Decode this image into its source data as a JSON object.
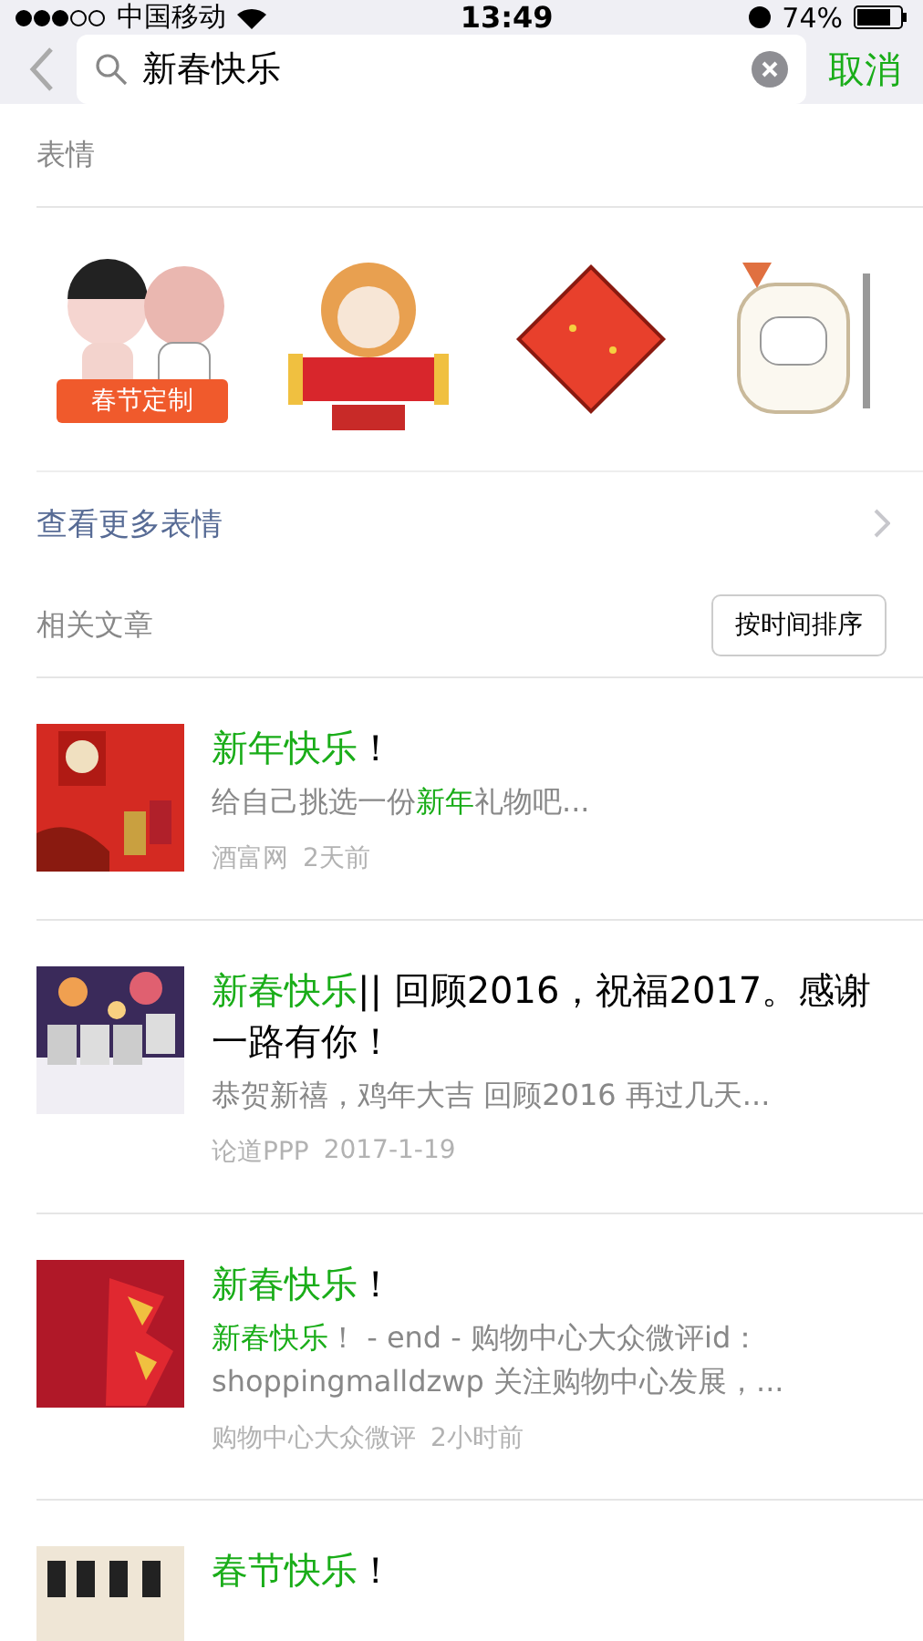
{
  "status_bar": {
    "carrier": "中国移动",
    "time": "13:49",
    "battery": "74%"
  },
  "search": {
    "value": "新春快乐",
    "cancel": "取消"
  },
  "stickers": {
    "title": "表情",
    "items": [
      {
        "kind": "picture",
        "badge": "春节定制"
      },
      {
        "kind": "picture"
      },
      {
        "kind": "picture"
      },
      {
        "kind": "picture"
      }
    ],
    "more": "查看更多表情"
  },
  "articles": {
    "title": "相关文章",
    "sort_button": "按时间排序",
    "items": [
      {
        "title": [
          {
            "text": "新年快乐",
            "highlight": true
          },
          {
            "text": "！",
            "highlight": false
          }
        ],
        "summary": [
          {
            "text": "给自己挑选一份",
            "highlight": false
          },
          {
            "text": "新年",
            "highlight": true
          },
          {
            "text": "礼物吧...",
            "highlight": false
          }
        ],
        "source": "酒富网",
        "time": "2天前"
      },
      {
        "title": [
          {
            "text": "新春快乐",
            "highlight": true
          },
          {
            "text": "|| 回顾2016，祝福2017。感谢一路有你！",
            "highlight": false
          }
        ],
        "summary": [
          {
            "text": "恭贺新禧，鸡年大吉 回顾2016 再过几天...",
            "highlight": false
          }
        ],
        "source": "论道PPP",
        "time": "2017-1-19"
      },
      {
        "title": [
          {
            "text": "新春快乐",
            "highlight": true
          },
          {
            "text": "！",
            "highlight": false
          }
        ],
        "summary": [
          {
            "text": "新春快乐",
            "highlight": true
          },
          {
            "text": "！  - end - 购物中心大众微评id：shoppingmalldzwp 关注购物中心发展，...",
            "highlight": false
          }
        ],
        "source": "购物中心大众微评",
        "time": "2小时前"
      },
      {
        "title": [
          {
            "text": "春节快乐",
            "highlight": true
          },
          {
            "text": "！",
            "highlight": false
          }
        ]
      }
    ]
  }
}
